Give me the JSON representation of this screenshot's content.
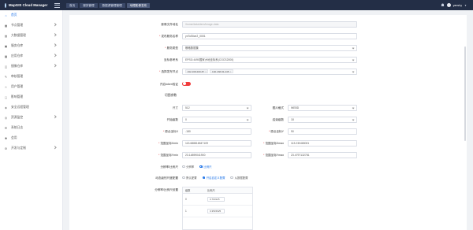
{
  "app": {
    "title": "MapGIS Cloud Manager",
    "user": "yanshy"
  },
  "breadcrumb": [
    "首页",
    "服务管理",
    "数据源管理管理",
    "地理影像发布"
  ],
  "sidebar": {
    "items": [
      {
        "label": "首页",
        "icon": "home-icon",
        "has_arrow": false
      },
      {
        "label": "节点管理",
        "icon": "node-icon",
        "has_arrow": true
      },
      {
        "label": "大数据管理",
        "icon": "bigdata-icon",
        "has_arrow": true
      },
      {
        "label": "服务仓库",
        "icon": "warehouse-icon",
        "has_arrow": true
      },
      {
        "label": "应用仓库",
        "icon": "app-icon",
        "has_arrow": true
      },
      {
        "label": "镜像仓库",
        "icon": "image-icon",
        "has_arrow": true
      },
      {
        "label": "审核管理",
        "icon": "audit-icon",
        "has_arrow": false
      },
      {
        "label": "用户管理",
        "icon": "user-icon",
        "has_arrow": false
      },
      {
        "label": "影响管理",
        "icon": "impact-icon",
        "has_arrow": false
      },
      {
        "label": "安全远程管理",
        "icon": "security-icon",
        "has_arrow": false
      },
      {
        "label": "资源监控",
        "icon": "monitor-icon",
        "has_arrow": true
      },
      {
        "label": "系统日志",
        "icon": "log-icon",
        "has_arrow": false
      },
      {
        "label": "会用",
        "icon": "star-icon",
        "has_arrow": false
      },
      {
        "label": "开发与定制",
        "icon": "dev-icon",
        "has_arrow": true
      }
    ]
  },
  "form": {
    "source_file": {
      "label": "影像文件地址",
      "value": "/home/data/dem/image-data"
    },
    "service_name": {
      "label": "发布服务名称",
      "value": "yxToSlice2_0001",
      "required": true
    },
    "service_type": {
      "label": "服务类型",
      "value": "栅格数据集",
      "required": true
    },
    "reference_system": {
      "label": "坐标参考系",
      "value": "EPSG:4490国家大地坐标系(CGCS2000)"
    },
    "publish_nodes": {
      "label": "选择发布节点",
      "required": true,
      "tags": [
        "192.168.200.87",
        "192.168.81.245"
      ]
    },
    "token_auth": {
      "label": "开启token验证"
    },
    "tile_section": {
      "title": "切图参数"
    },
    "size": {
      "label": "尺寸",
      "value": "512"
    },
    "image_format": {
      "label": "图片格式",
      "value": "WEBD"
    },
    "start_level": {
      "label": "开始级数",
      "value": "0"
    },
    "end_level": {
      "label": "结束级数",
      "value": "18"
    },
    "origin_x": {
      "label": "原点坐标X",
      "value": "-180",
      "required": true
    },
    "origin_y": {
      "label": "原点坐标Y",
      "value": "90",
      "required": true
    },
    "xmin": {
      "label": "范围坐标Xmin",
      "value": "113.688816547109",
      "required": true
    },
    "xmax": {
      "label": "范围坐标Xmax",
      "value": "113.230465001",
      "required": true
    },
    "ymin": {
      "label": "范围坐标Ymin",
      "value": "23.14899041900",
      "required": true
    },
    "ymax": {
      "label": "范围坐标Ymax",
      "value": "23.4797132781",
      "required": true
    },
    "scale_resolution": {
      "label": "分辨率/比例尺",
      "options": [
        "分辨率",
        "比例尺"
      ],
      "selected": 1
    },
    "dynamic_config": {
      "label": "动态级别尺度配置",
      "options": [
        "默认配置",
        "开启自定义配置",
        "从数据配置"
      ],
      "selected": 1
    },
    "scale_settings": {
      "label": "分辨率/比例尺设置",
      "columns": [
        "级数",
        "比例尺"
      ],
      "rows": [
        {
          "level": "0",
          "value": "0.703125"
        },
        {
          "level": "1",
          "value": "0.3515625"
        }
      ]
    }
  },
  "colors": {
    "topbar": "#232e46",
    "accent": "#1e73e8",
    "switch_off": "#f03c3c"
  }
}
